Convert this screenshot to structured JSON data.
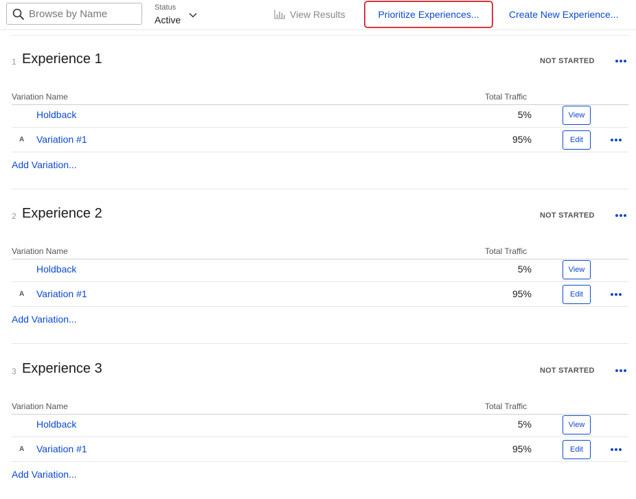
{
  "toolbar": {
    "search_placeholder": "Browse by Name",
    "status_label": "Status",
    "status_value": "Active",
    "view_results": "View Results",
    "prioritize": "Prioritize Experiences...",
    "create": "Create New Experience..."
  },
  "columns": {
    "name": "Variation Name",
    "traffic": "Total Traffic"
  },
  "experiences": [
    {
      "number": "1",
      "title": "Experience 1",
      "status": "NOT STARTED",
      "rows": [
        {
          "prefix": "",
          "name": "Holdback",
          "traffic": "5%",
          "button": "View"
        },
        {
          "prefix": "A",
          "name": "Variation #1",
          "traffic": "95%",
          "button": "Edit"
        }
      ],
      "add_label": "Add Variation..."
    },
    {
      "number": "2",
      "title": "Experience 2",
      "status": "NOT STARTED",
      "rows": [
        {
          "prefix": "",
          "name": "Holdback",
          "traffic": "5%",
          "button": "View"
        },
        {
          "prefix": "A",
          "name": "Variation #1",
          "traffic": "95%",
          "button": "Edit"
        }
      ],
      "add_label": "Add Variation..."
    },
    {
      "number": "3",
      "title": "Experience 3",
      "status": "NOT STARTED",
      "rows": [
        {
          "prefix": "",
          "name": "Holdback",
          "traffic": "5%",
          "button": "View"
        },
        {
          "prefix": "A",
          "name": "Variation #1",
          "traffic": "95%",
          "button": "Edit"
        }
      ],
      "add_label": "Add Variation..."
    }
  ],
  "colors": {
    "link": "#0b48d1",
    "highlight_border": "#d9343c"
  },
  "icons": {
    "search": "search-icon",
    "status_dropdown": "chevron-down-icon",
    "view_results": "bar-chart-icon",
    "more": "more-dots-icon"
  }
}
